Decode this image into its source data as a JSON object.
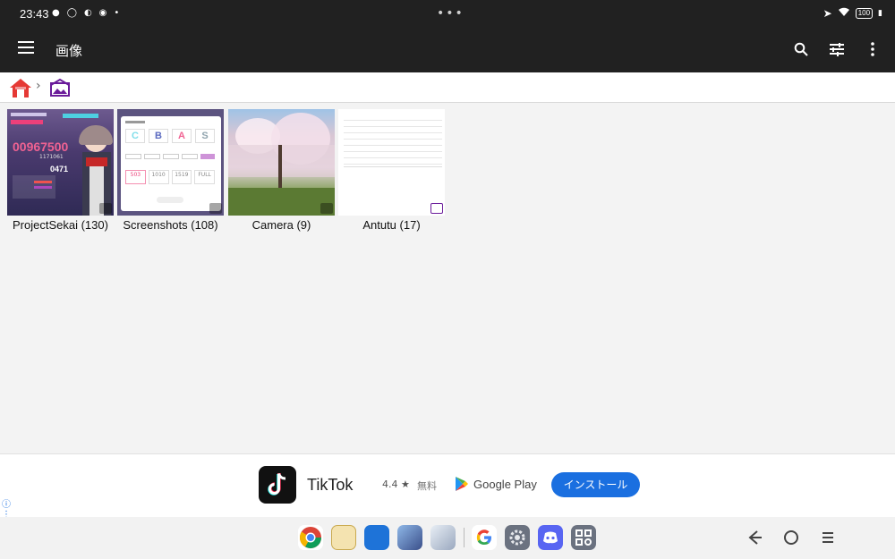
{
  "status_bar": {
    "time": "23:43",
    "battery": "100"
  },
  "app_bar": {
    "title": "画像"
  },
  "albums": [
    {
      "label": "ProjectSekai (130)",
      "badge": "camera-icon"
    },
    {
      "label": "Screenshots (108)",
      "badge": "screenshot-icon"
    },
    {
      "label": "Camera (9)",
      "badge": "camera-icon"
    },
    {
      "label": "Antutu (17)",
      "badge": "folder-icon"
    }
  ],
  "thumb_text": {
    "score": "00967500",
    "sub": "1171061",
    "combo": "0471",
    "ranks": [
      "C",
      "B",
      "A",
      "S"
    ],
    "stats": [
      "503",
      "1010",
      "1519",
      "FULL"
    ]
  },
  "ad": {
    "app_name": "TikTok",
    "rating": "4.4 ★",
    "price": "無料",
    "store": "Google Play",
    "install_label": "インストール"
  },
  "colors": {
    "bar": "#212121",
    "accent": "#1a6fe0",
    "folder": "#6a1b9a"
  }
}
